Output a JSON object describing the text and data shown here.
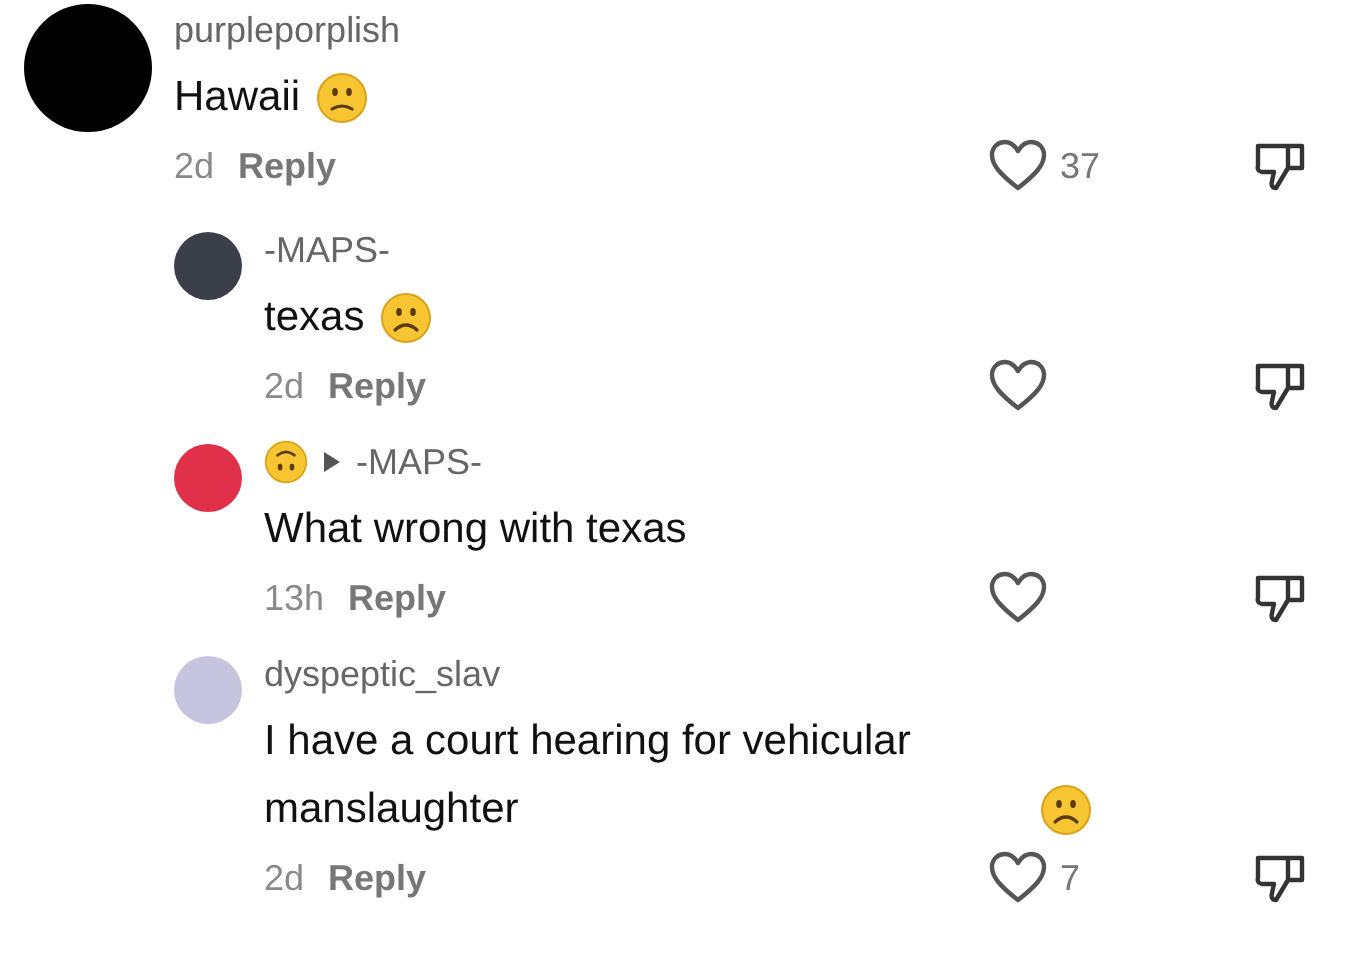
{
  "comments": [
    {
      "author": "purpleporplish",
      "text": "Hawaii",
      "sad_emoji": true,
      "time": "2d",
      "reply_label": "Reply",
      "likes": "37",
      "children": [
        {
          "author": "-MAPS-",
          "text": "texas",
          "sad_emoji": true,
          "time": "2d",
          "reply_label": "Reply",
          "color": "#3b3f4a"
        },
        {
          "emoji_author": true,
          "reply_to": "-MAPS-",
          "text": "What wrong with texas",
          "sad_emoji": false,
          "time": "13h",
          "reply_label": "Reply",
          "color": "#e0304a"
        },
        {
          "author": "dyspeptic_slav",
          "text": "I have a court hearing for vehicular manslaughter",
          "sad_emoji": true,
          "time": "2d",
          "reply_label": "Reply",
          "likes": "7",
          "color": "#c7c4e0"
        }
      ]
    }
  ]
}
